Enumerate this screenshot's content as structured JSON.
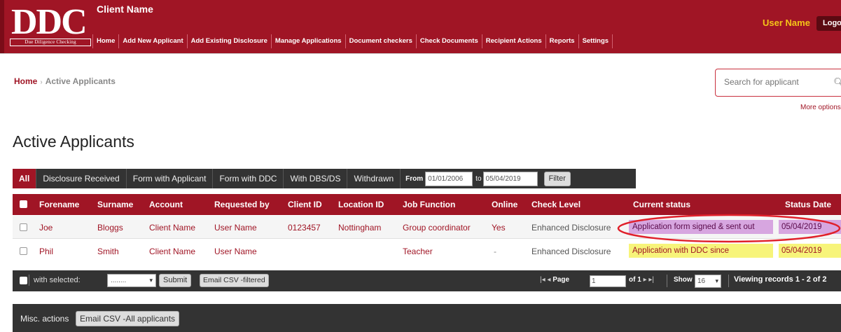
{
  "header": {
    "logo_text": "DDC",
    "logo_subtitle": "Due Diligence Checking",
    "client_name": "Client Name",
    "user_name": "User Name",
    "logout_label": "Logou",
    "nav": [
      "Home",
      "Add New Applicant",
      "Add Existing Disclosure",
      "Manage Applications",
      "Document checkers",
      "Check Documents",
      "Recipient Actions",
      "Reports",
      "Settings"
    ]
  },
  "breadcrumb": {
    "home": "Home",
    "separator": "›",
    "current": "Active Applicants"
  },
  "search": {
    "placeholder": "Search for applicant",
    "more_options": "More options"
  },
  "page_title": "Active Applicants",
  "tabs": [
    "All",
    "Disclosure Received",
    "Form with Applicant",
    "Form with DDC",
    "With DBS/DS",
    "Withdrawn"
  ],
  "date_filter": {
    "from_label": "From",
    "from_value": "01/01/2006",
    "to_label": "to",
    "to_value": "05/04/2019",
    "filter_label": "Filter"
  },
  "table": {
    "columns": [
      "Forename",
      "Surname",
      "Account",
      "Requested by",
      "Client ID",
      "Location ID",
      "Job Function",
      "Online",
      "Check Level",
      "Current status",
      "Status Date"
    ],
    "rows": [
      {
        "forename": "Joe",
        "surname": "Bloggs",
        "account": "Client Name",
        "requested_by": "User Name",
        "client_id": "0123457",
        "location_id": "Nottingham",
        "job_function": "Group coordinator",
        "online": "Yes",
        "check_level": "Enhanced Disclosure",
        "status": "Application form signed & sent out",
        "status_date": "05/04/2019"
      },
      {
        "forename": "Phil",
        "surname": "Smith",
        "account": "Client Name",
        "requested_by": "User Name",
        "client_id": "",
        "location_id": "",
        "job_function": "Teacher",
        "online": "-",
        "check_level": "Enhanced Disclosure",
        "status": "Application with DDC since",
        "status_date": "05/04/2019"
      }
    ]
  },
  "footer": {
    "with_selected": "with selected:",
    "select_value": "........",
    "submit_label": "Submit",
    "email_csv_filtered": "Email CSV -filtered",
    "pager_prefix": "|◂ ◂",
    "page_label": "Page",
    "page_value": "1",
    "of_label": "of 1",
    "pager_suffix": "▸ ▸|",
    "show_label": "Show",
    "show_value": "16",
    "viewing": "Viewing records 1 - 2 of 2"
  },
  "misc": {
    "label": "Misc. actions",
    "email_csv_all": "Email CSV -All applicants"
  },
  "colors": {
    "brand_red": "#a01525",
    "dark_bar": "#333333",
    "status_purple": "#d7a6e0",
    "status_yellow": "#f7f47a",
    "user_name_yellow": "#f5c518"
  },
  "icons": {
    "search": "magnifier-icon",
    "checkbox": "checkbox-icon",
    "caret": "caret-down-icon"
  }
}
